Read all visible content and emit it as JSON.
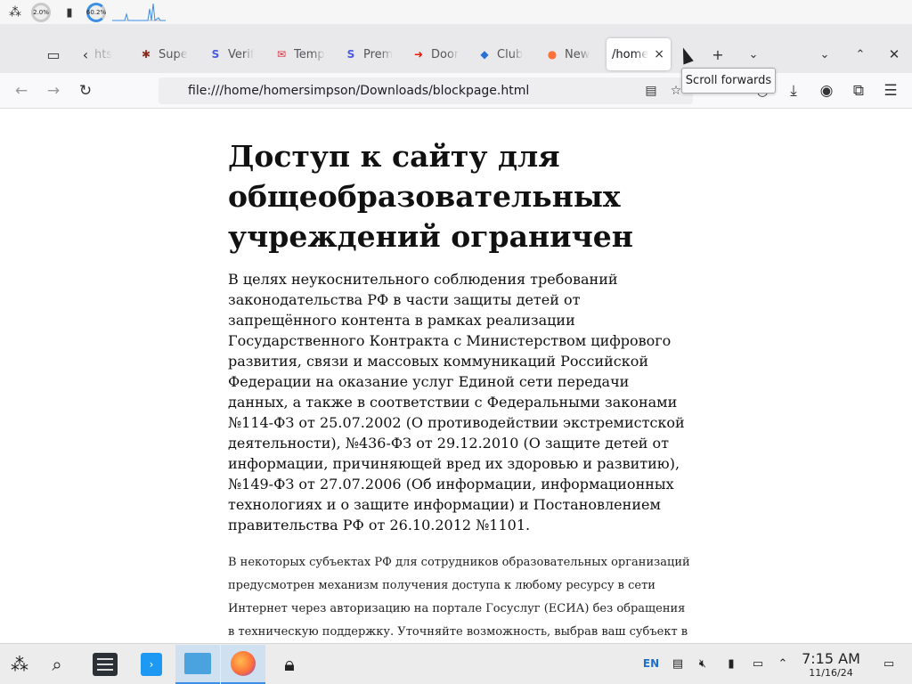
{
  "system_panel": {
    "cpu_label": "2.0%",
    "mem_label": "60.2%"
  },
  "browser": {
    "tabs": [
      {
        "label": "hts",
        "icon": "chevron-left-icon"
      },
      {
        "label": "Supe",
        "icon": "bug-icon"
      },
      {
        "label": "Verif",
        "icon": "s-logo-icon"
      },
      {
        "label": "Temp",
        "icon": "mail-icon"
      },
      {
        "label": "Prem",
        "icon": "s-logo-icon"
      },
      {
        "label": "Door",
        "icon": "doordash-icon"
      },
      {
        "label": "Club",
        "icon": "club-icon"
      },
      {
        "label": "New",
        "icon": "firefox-icon"
      },
      {
        "label": "/home",
        "icon": "none",
        "active": true
      }
    ],
    "active_tab_close": "×",
    "url": "file:///home/homersimpson/Downloads/blockpage.html",
    "tooltip": "Scroll forwards"
  },
  "page": {
    "heading": "Доступ к сайту для общеобразовательных учреждений ограничен",
    "paragraph": "В целях неукоснительного соблюдения требований законодательства РФ в части защиты детей от запрещённого контента в рамках реализации Государственного Контракта с Министерством цифрового развития, связи и массовых коммуникаций Российской Федерации на оказание услуг Единой сети передачи данных, а также в соответствии с Федеральными законами №114-ФЗ от 25.07.2002 (О противодействии экстремистской деятельности), №436-ФЗ от 29.12.2010 (О защите детей от информации, причиняющей вред их здоровью и развитию), №149-ФЗ от 27.07.2006 (Об информации, информационных технологиях и о защите информации) и Постановлением правительства РФ от 26.10.2012 №1101.",
    "small_paragraph": "В некоторых субъектах РФ для сотрудников образовательных организаций предусмотрен механизм получения доступа к любому ресурсу в сети Интернет через авторизацию на портале Госуслуг (ЕСИА) без обращения в техническую поддержку. Уточняйте возможность, выбрав ваш субъект в"
  },
  "taskbar": {
    "lang": "EN",
    "time": "7:15 AM",
    "date": "11/16/24"
  },
  "colors": {
    "accent": "#3d8ee6",
    "tabbar_bg": "#e9e9ec",
    "taskbar_bg": "#ececec"
  }
}
